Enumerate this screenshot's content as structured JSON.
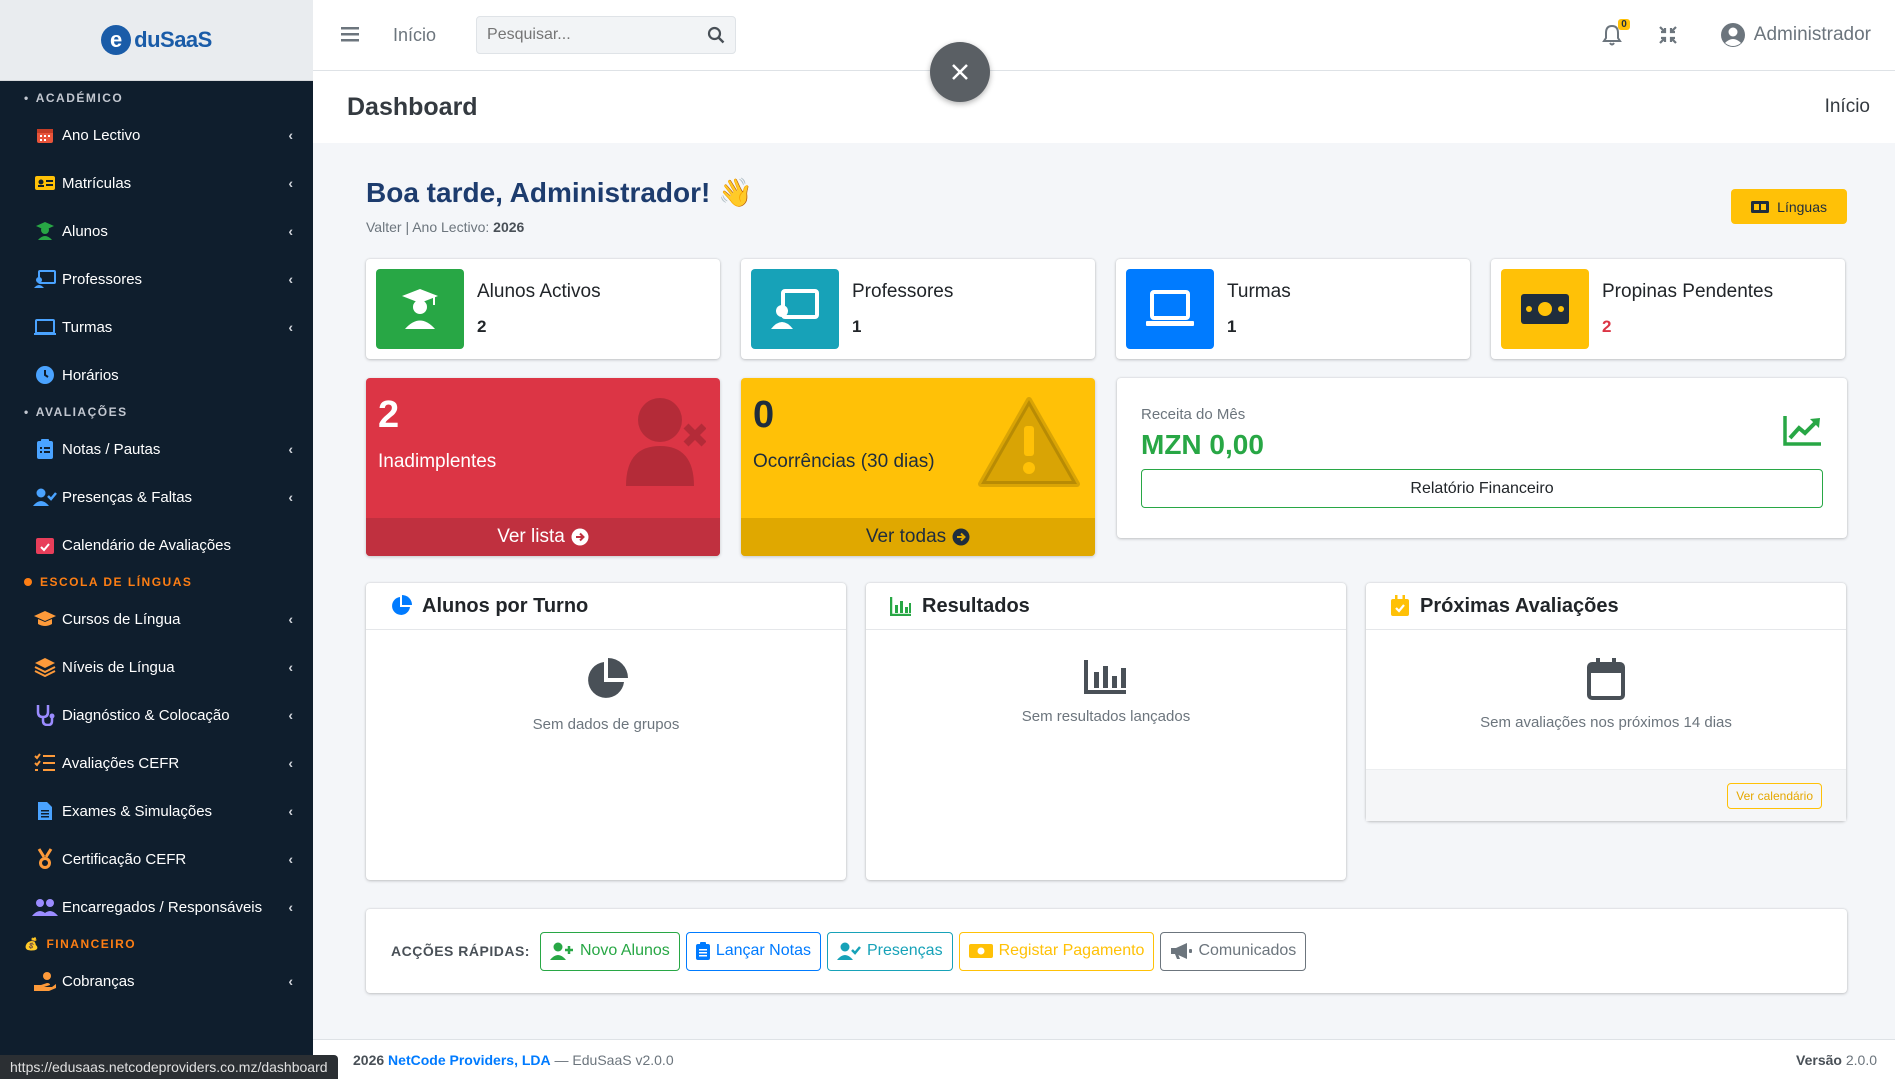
{
  "brand": {
    "logo_letter": "e",
    "logo_text": "duSaaS"
  },
  "sidebar": {
    "sections": [
      {
        "header": "ACADÉMICO",
        "items": [
          {
            "label": "Ano Lectivo",
            "icon": "calendar-grid-icon",
            "chevron": true
          },
          {
            "label": "Matrículas",
            "icon": "id-card-icon",
            "chevron": true
          },
          {
            "label": "Alunos",
            "icon": "student-icon",
            "chevron": true
          },
          {
            "label": "Professores",
            "icon": "teacher-board-icon",
            "chevron": true
          },
          {
            "label": "Turmas",
            "icon": "classroom-monitor-icon",
            "chevron": true
          },
          {
            "label": "Horários",
            "icon": "clock-icon",
            "chevron": false
          }
        ]
      },
      {
        "header": "AVALIAÇÕES",
        "items": [
          {
            "label": "Notas / Pautas",
            "icon": "clipboard-list-icon",
            "chevron": true
          },
          {
            "label": "Presenças & Faltas",
            "icon": "user-check-icon",
            "chevron": true
          },
          {
            "label": "Calendário de Avaliações",
            "icon": "calendar-check-icon",
            "chevron": false
          }
        ]
      },
      {
        "header": "ESCOLA DE LÍNGUAS",
        "items": [
          {
            "label": "Cursos de Língua",
            "icon": "graduation-cap-icon",
            "chevron": true
          },
          {
            "label": "Níveis de Língua",
            "icon": "layers-icon",
            "chevron": true
          },
          {
            "label": "Diagnóstico & Colocação",
            "icon": "stethoscope-icon",
            "chevron": true
          },
          {
            "label": "Avaliações CEFR",
            "icon": "list-check-icon",
            "chevron": true
          },
          {
            "label": "Exames & Simulações",
            "icon": "file-alt-icon",
            "chevron": true
          },
          {
            "label": "Certificação CEFR",
            "icon": "medal-icon",
            "chevron": true
          },
          {
            "label": "Encarregados / Responsáveis",
            "icon": "users-icon",
            "chevron": true
          }
        ]
      },
      {
        "header": "FINANCEIRO",
        "items": [
          {
            "label": "Cobranças",
            "icon": "hand-coin-icon",
            "chevron": true
          }
        ]
      }
    ]
  },
  "statusbar": {
    "url": "https://edusaas.netcodeproviders.co.mz/dashboard"
  },
  "topbar": {
    "home_link": "Início",
    "search_placeholder": "Pesquisar...",
    "notification_count": "0",
    "user_name": "Administrador"
  },
  "content_header": {
    "title": "Dashboard",
    "breadcrumb": "Início"
  },
  "greeting": {
    "title": "Boa tarde, Administrador!",
    "emoji": "👋",
    "user": "Valter",
    "separator": "|",
    "year_label": "Ano Lectivo:",
    "year_value": "2026",
    "lang_button": "Línguas"
  },
  "info_boxes": [
    {
      "title": "Alunos Activos",
      "value": "2",
      "color": "#28a745",
      "value_color": "#212529",
      "icon": "graduate-icon"
    },
    {
      "title": "Professores",
      "value": "1",
      "color": "#17a2b8",
      "value_color": "#212529",
      "icon": "teacher-board-icon"
    },
    {
      "title": "Turmas",
      "value": "1",
      "color": "#007bff",
      "value_color": "#212529",
      "icon": "classroom-monitor-icon"
    },
    {
      "title": "Propinas Pendentes",
      "value": "2",
      "color": "#ffc107",
      "value_color": "#dc3545",
      "icon": "money-bill-icon"
    }
  ],
  "small_boxes": [
    {
      "value": "2",
      "label": "Inadimplentes",
      "footer": "Ver lista",
      "bg": "#dc3545",
      "footer_bg": "#c0303f",
      "fg": "#ffffff",
      "icon": "user-times-icon"
    },
    {
      "value": "0",
      "label": "Ocorrências (30 dias)",
      "footer": "Ver todas",
      "bg": "#ffc107",
      "footer_bg": "#e0a800",
      "fg": "#1f2d3d",
      "icon": "warning-triangle-icon"
    }
  ],
  "revenue": {
    "label": "Receita do Mês",
    "value": "MZN 0,00",
    "button": "Relatório Financeiro"
  },
  "cards": [
    {
      "title": "Alunos por Turno",
      "empty": "Sem dados de grupos",
      "icon": "pie-chart-icon"
    },
    {
      "title": "Resultados",
      "empty": "Sem resultados lançados",
      "icon": "bar-chart-icon"
    },
    {
      "title": "Próximas Avaliações",
      "empty": "Sem avaliações nos próximos 14 dias",
      "icon": "calendar-icon",
      "footer_button": "Ver calendário"
    }
  ],
  "quick_actions": {
    "label": "ACÇÕES RÁPIDAS:",
    "buttons": [
      {
        "label": "Novo Alunos",
        "color": "#28a745",
        "icon": "user-plus-icon"
      },
      {
        "label": "Lançar Notas",
        "color": "#007bff",
        "icon": "clipboard-icon"
      },
      {
        "label": "Presenças",
        "color": "#17a2b8",
        "icon": "user-check-icon"
      },
      {
        "label": "Registar Pagamento",
        "color": "#ffc107",
        "icon": "money-bill-icon"
      },
      {
        "label": "Comunicados",
        "color": "#6c757d",
        "icon": "megaphone-icon"
      }
    ]
  },
  "footer": {
    "copyright": "2026",
    "company": "NetCode Providers, LDA",
    "product": "— EduSaaS v2.0.0",
    "version_label": "Versão",
    "version_value": "2.0.0"
  }
}
